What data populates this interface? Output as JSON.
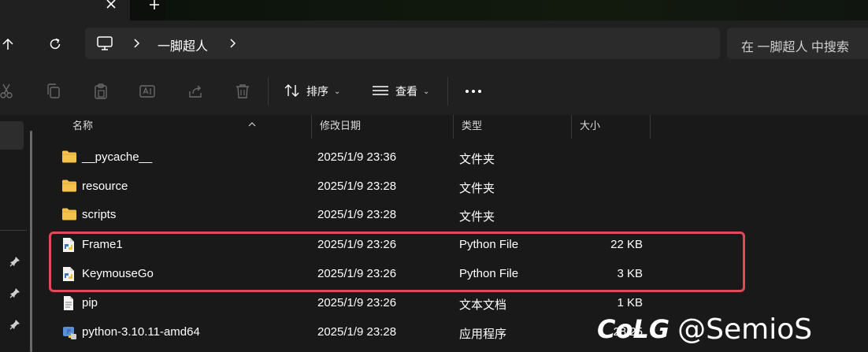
{
  "tabstrip": {
    "close_icon": "close-icon",
    "new_tab_icon": "plus-icon"
  },
  "nav": {
    "up_icon": "arrow-up-icon",
    "refresh_icon": "refresh-icon",
    "address": {
      "computer_icon": "computer-icon",
      "crumb": "一脚超人"
    },
    "search_placeholder": "在 一脚超人 中搜索"
  },
  "commandbar": {
    "icons": [
      "cut-icon",
      "copy-icon",
      "paste-icon",
      "rename-icon",
      "share-icon",
      "delete-icon"
    ],
    "sort_label": "排序",
    "view_label": "查看",
    "more_icon": "more-icon"
  },
  "columns": {
    "name": "名称",
    "modified": "修改日期",
    "type": "类型",
    "size": "大小"
  },
  "files": [
    {
      "icon": "folder-icon",
      "name": "__pycache__",
      "date": "2025/1/9 23:36",
      "type": "文件夹",
      "size": ""
    },
    {
      "icon": "folder-icon",
      "name": "resource",
      "date": "2025/1/9 23:28",
      "type": "文件夹",
      "size": ""
    },
    {
      "icon": "folder-icon",
      "name": "scripts",
      "date": "2025/1/9 23:28",
      "type": "文件夹",
      "size": ""
    },
    {
      "icon": "python-file-icon",
      "name": "Frame1",
      "date": "2025/1/9 23:26",
      "type": "Python File",
      "size": "22 KB"
    },
    {
      "icon": "python-file-icon",
      "name": "KeymouseGo",
      "date": "2025/1/9 23:26",
      "type": "Python File",
      "size": "3 KB"
    },
    {
      "icon": "text-file-icon",
      "name": "pip",
      "date": "2025/1/9 23:26",
      "type": "文本文档",
      "size": "1 KB"
    },
    {
      "icon": "installer-icon",
      "name": "python-3.10.11-amd64",
      "date": "2025/1/9 23:28",
      "type": "应用程序",
      "size": "28,25"
    }
  ],
  "watermark": {
    "logo": "CoLG",
    "handle": "@SemioS"
  },
  "colors": {
    "highlight": "#e0495a",
    "folder": "#f2c14e",
    "background": "#191919"
  }
}
